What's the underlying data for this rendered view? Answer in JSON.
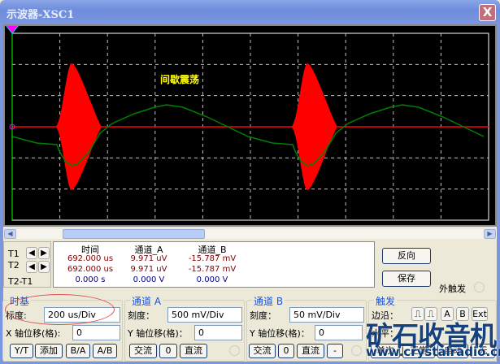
{
  "window": {
    "title": "示波器-XSC1",
    "close_label": "X"
  },
  "screen": {
    "annotation": "间歇震荡",
    "colors": {
      "channel_a": "#ff0000",
      "channel_b": "#008000",
      "annotation": "#ffff00",
      "grid": "#c0c0c0"
    }
  },
  "cursors": {
    "t1": "T1",
    "t2": "T2",
    "t2t1": "T2-T1",
    "left_arrow": "🡐",
    "right_arrow": "🡒"
  },
  "readout": {
    "headers": [
      "时间",
      "通道_A",
      "通道_B"
    ],
    "rows": [
      [
        "692.000 us",
        "9.971 uV",
        "-15.787 mV"
      ],
      [
        "692.000 us",
        "9.971 uV",
        "-15.787 mV"
      ],
      [
        "0.000 s",
        "0.000 V",
        "0.000 V"
      ]
    ]
  },
  "buttons": {
    "reverse": "反向",
    "save": "保存",
    "ext_trigger": "外触发"
  },
  "timebase": {
    "title": "时基",
    "scale_label": "标度:",
    "scale": "200 us/Div",
    "xpos_label": "X 轴位移(格):",
    "xpos": "0",
    "modes": [
      "Y/T",
      "添加",
      "B/A",
      "A/B"
    ]
  },
  "channel_a": {
    "title": "通道 A",
    "scale_label": "刻度：",
    "scale": "500 mV/Div",
    "ypos_label": "Y 轴位移(格)：",
    "ypos": "0",
    "coupling": [
      "交流",
      "0",
      "直流"
    ]
  },
  "channel_b": {
    "title": "通道 B",
    "scale_label": "刻度：",
    "scale": "50 mV/Div",
    "ypos_label": "Y 轴位移(格)：",
    "ypos": "0",
    "coupling": [
      "交流",
      "0",
      "直流",
      "-"
    ]
  },
  "trigger": {
    "title": "触发",
    "edge_label": "边沿：",
    "level_label": "水平：",
    "modes": [
      "单次",
      "正常",
      "自动",
      "无"
    ]
  },
  "watermark": {
    "text": "矿石收音机",
    "url": "www.crystalradio.cn"
  }
}
